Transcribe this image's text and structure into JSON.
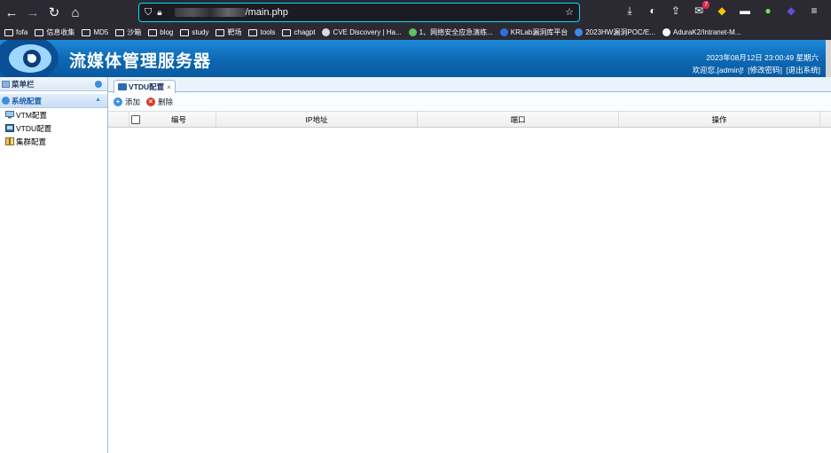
{
  "browser": {
    "url_suffix": "/main.php",
    "bookmarks": [
      {
        "label": "fofa",
        "kind": "folder"
      },
      {
        "label": "信息收集",
        "kind": "folder"
      },
      {
        "label": "MD5",
        "kind": "folder"
      },
      {
        "label": "沙箱",
        "kind": "folder"
      },
      {
        "label": "blog",
        "kind": "folder"
      },
      {
        "label": "study",
        "kind": "folder"
      },
      {
        "label": "靶场",
        "kind": "folder"
      },
      {
        "label": "tools",
        "kind": "folder"
      },
      {
        "label": "chagpt",
        "kind": "folder"
      },
      {
        "label": "CVE Discovery | Ha...",
        "kind": "site"
      },
      {
        "label": "1、网络安全应急演练...",
        "kind": "site"
      },
      {
        "label": "KRLab漏洞库平台",
        "kind": "site"
      },
      {
        "label": "2023HW漏洞POC/E...",
        "kind": "site"
      },
      {
        "label": "AduraK2/Intranet-M...",
        "kind": "site"
      }
    ],
    "extension_badge": "7"
  },
  "header": {
    "title": "流媒体管理服务器",
    "datetime": "2023年08月12日 23:00:49 星期六",
    "welcome": "欢迎您,[admin]!",
    "change_password": "[修改密码]",
    "logout": "[退出系统]"
  },
  "sidebar": {
    "menu_title": "菜单栏",
    "section_title": "系统配置",
    "items": [
      {
        "label": "VTM配置",
        "icon": "monitor-icon"
      },
      {
        "label": "VTDU配置",
        "icon": "terminal-icon"
      },
      {
        "label": "集群配置",
        "icon": "book-icon"
      }
    ]
  },
  "main": {
    "tab_label": "VTDU配置",
    "tab_close": "×",
    "actions": {
      "add": "添加",
      "delete": "删除"
    },
    "columns": [
      "编号",
      "IP地址",
      "端口",
      "操作"
    ]
  },
  "colors": {
    "banner": "#0c67b3",
    "accent": "#3d8ee0",
    "add_green": "#3b9a3b",
    "delete_red": "#d83a2a"
  }
}
